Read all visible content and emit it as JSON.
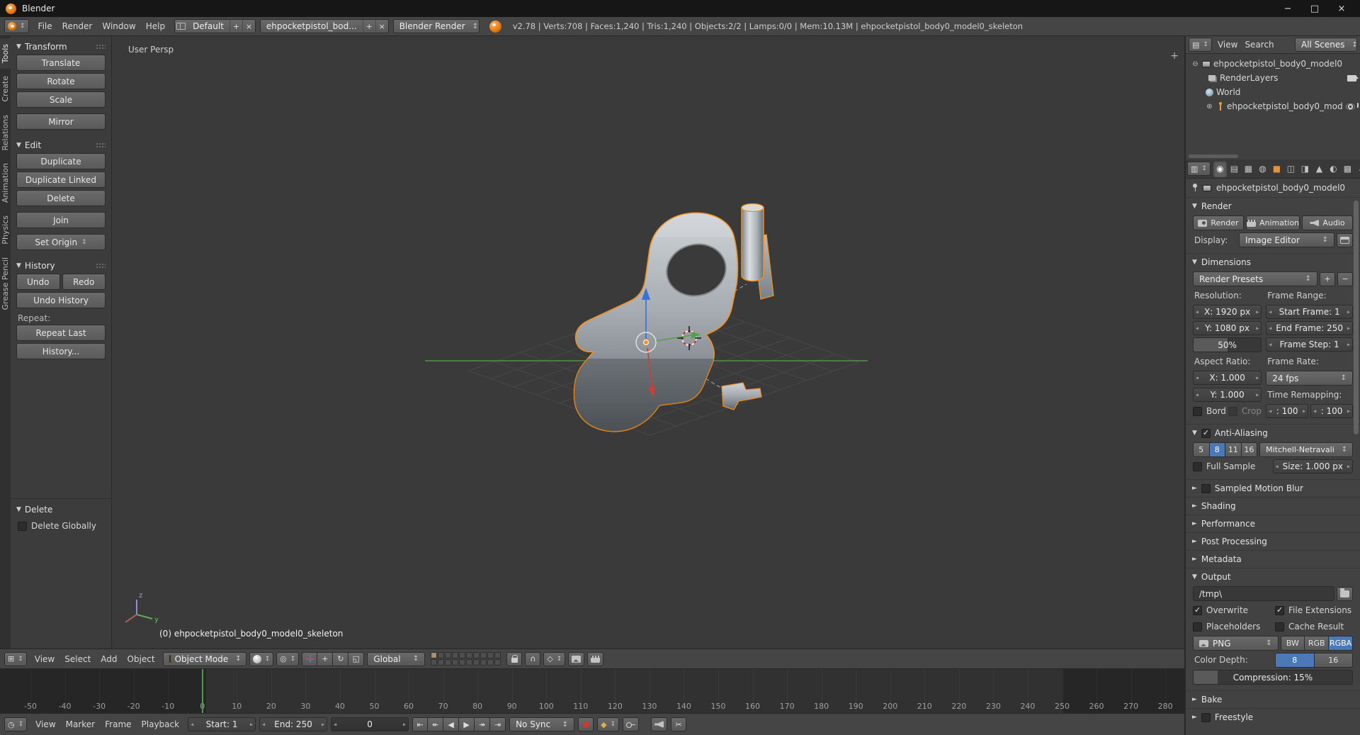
{
  "icons": {
    "caret_open": "▼",
    "caret_closed": "►",
    "plus": "+",
    "minus": "−",
    "expanded": "⊖",
    "collapsed": "⊕",
    "editor_3d_view": "⊞",
    "editor_timeline": "◷",
    "editor_outliner": "▤",
    "editor_properties": "▥",
    "pivot": "◎",
    "magnet": "∩",
    "snap_element": "◇",
    "manip_translate": "+",
    "manip_rotate": "↻",
    "manip_scale": "◱",
    "keying_diamond": "◆",
    "scissors": "✂",
    "tabs": {
      "render": "◉",
      "render-layers": "▤",
      "scene": "▦",
      "world": "◍",
      "object": "■",
      "constraints": "◫",
      "modifiers": "◨",
      "data": "▲",
      "material": "◐",
      "texture": "▩",
      "particles": "∴",
      "physics": "◎"
    }
  },
  "titlebar": {
    "title": "Blender",
    "minimize": "−",
    "maximize": "□",
    "close": "×"
  },
  "menubar": {
    "menus": [
      "File",
      "Render",
      "Window",
      "Help"
    ],
    "layout_value": "Default",
    "scene_value": "ehpocketpistol_bod...",
    "engine_value": "Blender Render",
    "stats": "v2.78 | Verts:708 | Faces:1,240 | Tris:1,240 | Objects:2/2 | Lamps:0/0 | Mem:10.13M | ehpocketpistol_body0_model0_skeleton"
  },
  "toolshelf": {
    "tabs": [
      "Tools",
      "Create",
      "Relations",
      "Animation",
      "Physics",
      "Grease Pencil"
    ],
    "active_tab": "Tools",
    "transform": {
      "title": "Transform",
      "translate": "Translate",
      "rotate": "Rotate",
      "scale": "Scale",
      "mirror": "Mirror"
    },
    "edit": {
      "title": "Edit",
      "duplicate": "Duplicate",
      "duplicate_linked": "Duplicate Linked",
      "delete": "Delete",
      "join": "Join",
      "set_origin": "Set Origin"
    },
    "history": {
      "title": "History",
      "undo": "Undo",
      "redo": "Redo",
      "undo_history": "Undo History",
      "repeat_label": "Repeat:",
      "repeat_last": "Repeat Last",
      "history": "History..."
    },
    "operator": {
      "title": "Delete",
      "checkbox_label": "Delete Globally",
      "checked": false
    }
  },
  "viewport": {
    "view_label": "User Persp",
    "active_object": "(0) ehpocketpistol_body0_model0_skeleton",
    "axis": {
      "y": "y",
      "z": "z"
    },
    "header": {
      "menus": [
        "View",
        "Select",
        "Add",
        "Object"
      ],
      "mode": "Object Mode",
      "orientation": "Global"
    }
  },
  "timeline": {
    "ruler_start": -50,
    "ruler_end": 280,
    "ruler_step": 10,
    "current_frame": 0,
    "frame_start": 1,
    "frame_end": 250,
    "header": {
      "menus": [
        "View",
        "Marker",
        "Frame",
        "Playback"
      ],
      "start_field": "Start: 1",
      "end_field": "End: 250",
      "frame_field": "0",
      "sync": "No Sync",
      "transport": [
        {
          "name": "jump-to-start",
          "glyph": "⇤"
        },
        {
          "name": "jump-to-prev-keyframe",
          "glyph": "↞"
        },
        {
          "name": "play-reverse",
          "glyph": "◀"
        },
        {
          "name": "play",
          "glyph": "▶"
        },
        {
          "name": "jump-to-next-keyframe",
          "glyph": "↠"
        },
        {
          "name": "jump-to-end",
          "glyph": "⇥"
        }
      ]
    }
  },
  "outliner": {
    "header": {
      "menus": [
        "View",
        "Search"
      ],
      "display_mode": "All Scenes"
    },
    "items": [
      {
        "label": "ehpocketpistol_body0_model0"
      },
      {
        "label": "RenderLayers"
      },
      {
        "label": "World"
      },
      {
        "label": "ehpocketpistol_body0_mod"
      }
    ]
  },
  "properties": {
    "tabs": [
      "render",
      "render-layers",
      "scene",
      "world",
      "object",
      "constraints",
      "modifiers",
      "data",
      "material",
      "texture",
      "particles",
      "physics"
    ],
    "breadcrumb": "ehpocketpistol_body0_model0",
    "render_panel": {
      "title": "Render",
      "render": "Render",
      "animation": "Animation",
      "audio": "Audio",
      "display_label": "Display:",
      "display_value": "Image Editor"
    },
    "dimensions_panel": {
      "title": "Dimensions",
      "presets": "Render Presets",
      "resolution_label": "Resolution:",
      "res_x": "X: 1920 px",
      "res_y": "Y: 1080 px",
      "res_pct": "50%",
      "res_pct_fill": 50,
      "frame_range_label": "Frame Range:",
      "start_frame": "Start Frame: 1",
      "end_frame": "End Frame: 250",
      "frame_step": "Frame Step: 1",
      "aspect_label": "Aspect Ratio:",
      "aspect_x": "X: 1.000",
      "aspect_y": "Y: 1.000",
      "frame_rate_label": "Frame Rate:",
      "frame_rate": "24 fps",
      "time_remap_label": "Time Remapping:",
      "remap_old": ": 100",
      "remap_new": ": 100",
      "border_label": "Bord",
      "crop_label": "Crop"
    },
    "aa_panel": {
      "title": "Anti-Aliasing",
      "enabled": true,
      "samples": [
        "5",
        "8",
        "11",
        "16"
      ],
      "active_sample": "8",
      "filter": "Mitchell-Netravali",
      "full_sample_label": "Full Sample",
      "size_field": "Size: 1.000 px"
    },
    "collapsed_1": [
      {
        "title": "Sampled Motion Blur",
        "checkbox": false
      },
      {
        "title": "Shading"
      },
      {
        "title": "Performance"
      },
      {
        "title": "Post Processing"
      },
      {
        "title": "Metadata"
      }
    ],
    "output_panel": {
      "title": "Output",
      "path": "/tmp\\",
      "checkboxes": [
        {
          "label": "Overwrite",
          "checked": true
        },
        {
          "label": "File Extensions",
          "checked": true
        },
        {
          "label": "Placeholders",
          "checked": false
        },
        {
          "label": "Cache Result",
          "checked": false
        }
      ],
      "format": "PNG",
      "channels": [
        "BW",
        "RGB",
        "RGBA"
      ],
      "active_channel": "RGBA",
      "color_depth_label": "Color Depth:",
      "depths": [
        "8",
        "16"
      ],
      "active_depth": "8",
      "compression": "Compression: 15%",
      "compression_fill": 15
    },
    "collapsed_2": [
      {
        "title": "Bake"
      },
      {
        "title": "Freestyle",
        "checkbox": false
      }
    ]
  }
}
